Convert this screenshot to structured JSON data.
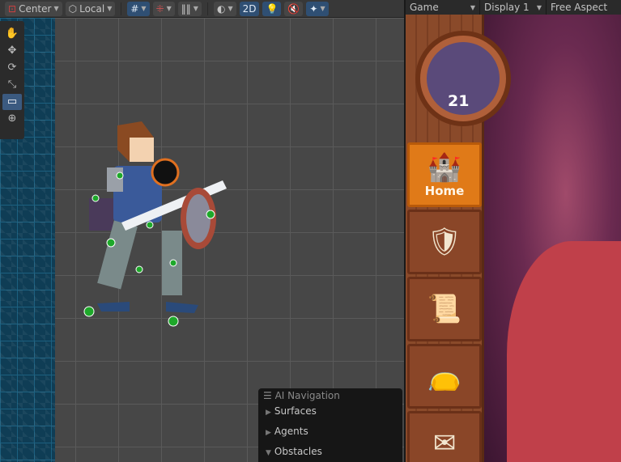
{
  "scene_toolbar": {
    "pivot": "Center",
    "space": "Local",
    "mode_2d": "2D"
  },
  "tools": [
    "hand",
    "move",
    "rotate",
    "scale",
    "rect",
    "transform"
  ],
  "ai_navigation": {
    "title": "AI Navigation",
    "items": [
      {
        "label": "Surfaces",
        "expanded": false
      },
      {
        "label": "Agents",
        "expanded": false
      },
      {
        "label": "Obstacles",
        "expanded": true
      }
    ]
  },
  "game_toolbar": {
    "view": "Game",
    "display": "Display 1",
    "aspect": "Free Aspect"
  },
  "game": {
    "level": "21",
    "menu": [
      {
        "label": "Home",
        "icon": "castle-icon",
        "active": true
      },
      {
        "label": "",
        "icon": "shield-sword-icon"
      },
      {
        "label": "",
        "icon": "scroll-quill-icon"
      },
      {
        "label": "",
        "icon": "bag-icon"
      },
      {
        "label": "",
        "icon": "envelope-icon"
      }
    ]
  }
}
